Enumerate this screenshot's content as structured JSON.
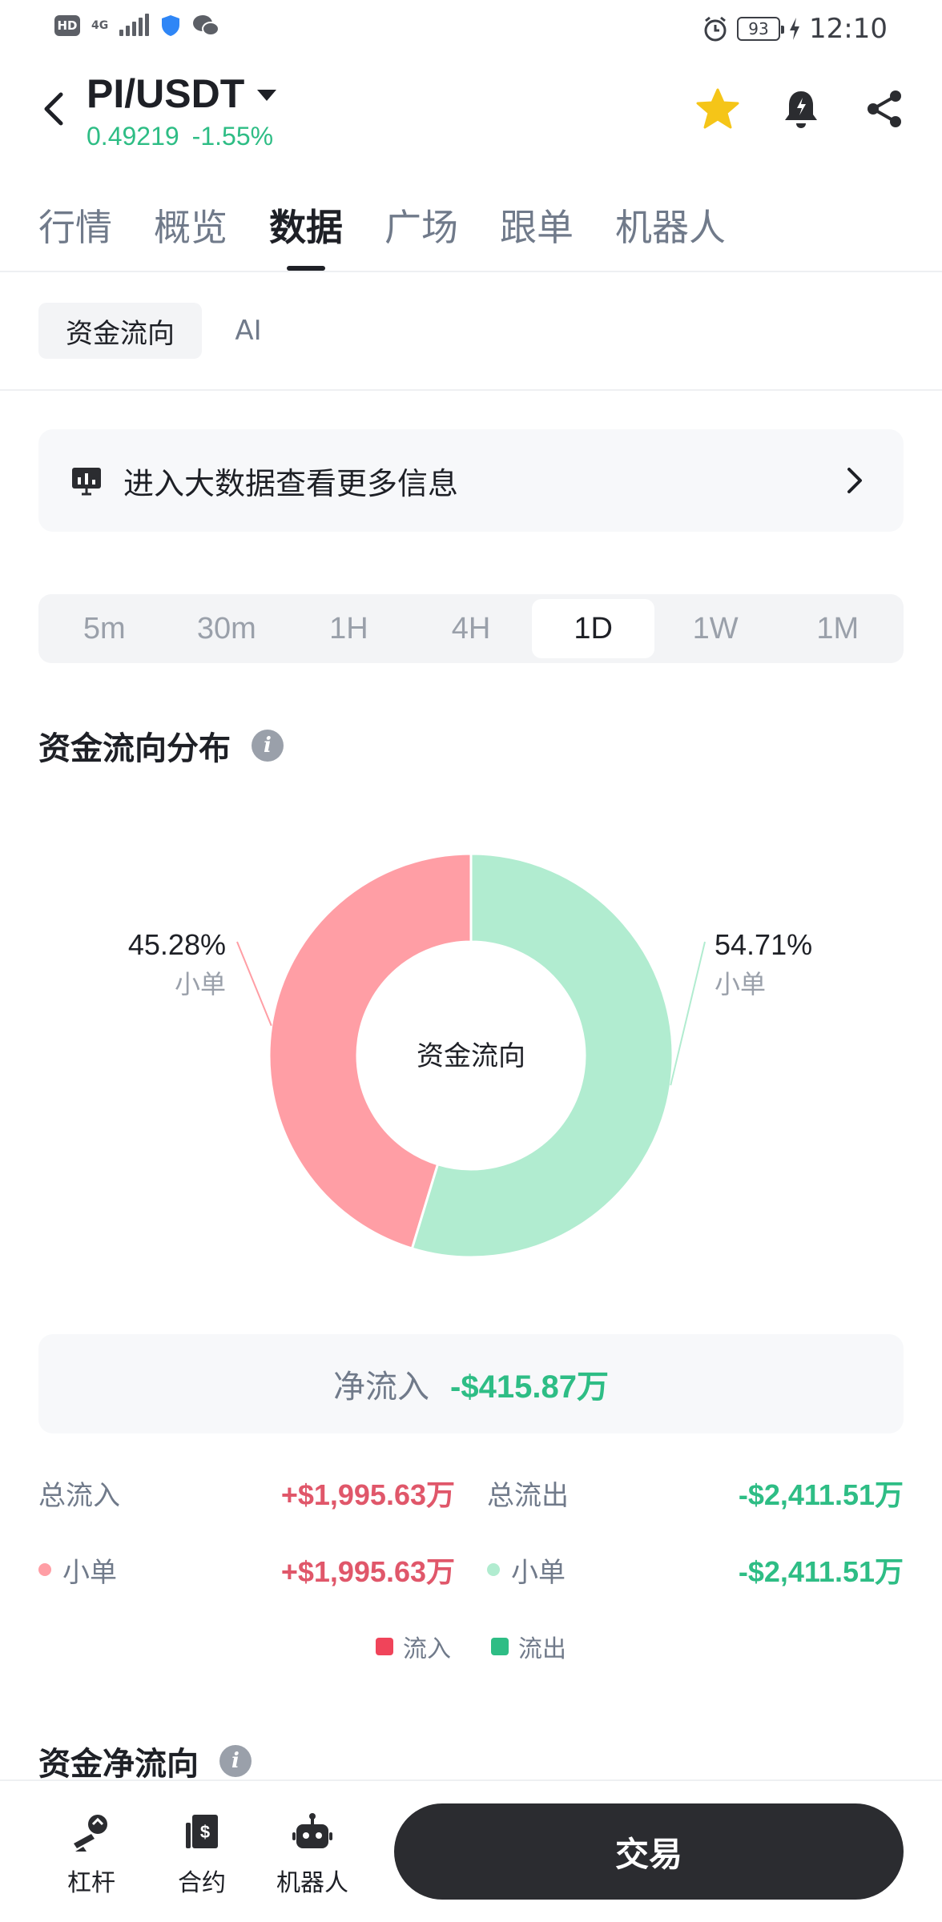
{
  "status_bar": {
    "hd": "HD",
    "network": "4G",
    "battery": "93",
    "time": "12:10"
  },
  "header": {
    "pair": "PI/USDT",
    "price": "0.49219",
    "change": "-1.55%",
    "icons": [
      "back-arrow-icon",
      "star-icon",
      "bell-icon",
      "share-icon"
    ]
  },
  "tabs": [
    "行情",
    "概览",
    "数据",
    "广场",
    "跟单",
    "机器人"
  ],
  "active_tab": "数据",
  "sub_tabs": {
    "active": "资金流向",
    "ai": "AI"
  },
  "banner": {
    "text": "进入大数据查看更多信息"
  },
  "intervals": [
    "5m",
    "30m",
    "1H",
    "4H",
    "1D",
    "1W",
    "1M"
  ],
  "active_interval": "1D",
  "distribution": {
    "title": "资金流向分布",
    "center_label": "资金流向",
    "inflow_pct": "45.28%",
    "inflow_label": "小单",
    "outflow_pct": "54.71%",
    "outflow_label": "小单"
  },
  "chart_data": {
    "type": "pie",
    "categories": [
      "小单",
      "小单"
    ],
    "values": [
      45.28,
      54.71
    ],
    "colors": [
      "#ff9ea5",
      "#b1ecd0"
    ]
  },
  "net_flow": {
    "label": "净流入",
    "value": "-$415.87万"
  },
  "totals": {
    "inflow_label": "总流入",
    "inflow_value": "+$1,995.63万",
    "outflow_label": "总流出",
    "outflow_value": "-$2,411.51万"
  },
  "small_orders": {
    "inflow_label": "小单",
    "inflow_value": "+$1,995.63万",
    "outflow_label": "小单",
    "outflow_value": "-$2,411.51万"
  },
  "legend": {
    "in": "流入",
    "out": "流出"
  },
  "net_direction": {
    "title": "资金净流向"
  },
  "bottom_nav": {
    "leverage": "杠杆",
    "contract": "合约",
    "robot": "机器人",
    "trade": "交易"
  },
  "colors": {
    "up": "#2ebd85",
    "down": "#e0576a",
    "pie_in": "#ff9ea5",
    "pie_out": "#b1ecd0",
    "star": "#f5c518"
  }
}
